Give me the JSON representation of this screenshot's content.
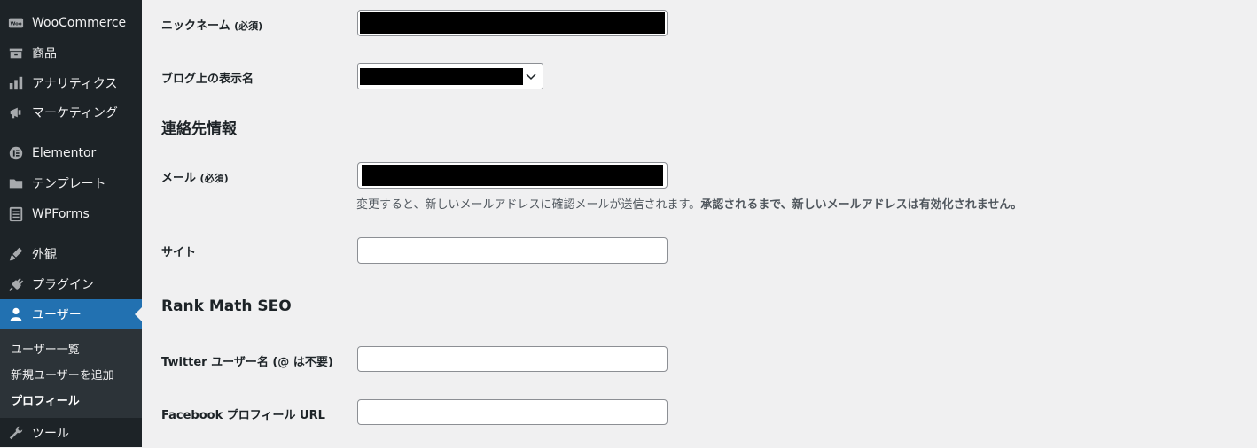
{
  "sidebar": {
    "items": [
      {
        "label": "WooCommerce",
        "icon": "woo-icon"
      },
      {
        "label": "商品",
        "icon": "archive-icon"
      },
      {
        "label": "アナリティクス",
        "icon": "chart-bar-icon"
      },
      {
        "label": "マーケティング",
        "icon": "megaphone-icon"
      },
      {
        "label": "Elementor",
        "icon": "elementor-icon"
      },
      {
        "label": "テンプレート",
        "icon": "folder-icon"
      },
      {
        "label": "WPForms",
        "icon": "form-icon"
      },
      {
        "label": "外観",
        "icon": "paintbrush-icon"
      },
      {
        "label": "プラグイン",
        "icon": "plugin-icon"
      },
      {
        "label": "ユーザー",
        "icon": "user-icon"
      },
      {
        "label": "ツール",
        "icon": "wrench-icon"
      }
    ],
    "submenu": [
      "ユーザー一覧",
      "新規ユーザーを追加",
      "プロフィール"
    ],
    "woo_badge": "Woo"
  },
  "form": {
    "nickname_label": "ニックネーム",
    "required": "(必須)",
    "display_name_label": "ブログ上の表示名",
    "contact_heading": "連絡先情報",
    "email_label": "メール",
    "email_desc_normal": "変更すると、新しいメールアドレスに確認メールが送信されます。",
    "email_desc_bold": "承認されるまで、新しいメールアドレスは有効化されません。",
    "site_label": "サイト",
    "seo_heading": "Rank Math SEO",
    "twitter_label": "Twitter ユーザー名 (@ は不要)",
    "facebook_label": "Facebook プロフィール URL"
  },
  "colors": {
    "sidebar_bg": "#1d2327",
    "active_bg": "#2271b1",
    "submenu_bg": "#2c3338",
    "page_bg": "#f0f0f1"
  }
}
